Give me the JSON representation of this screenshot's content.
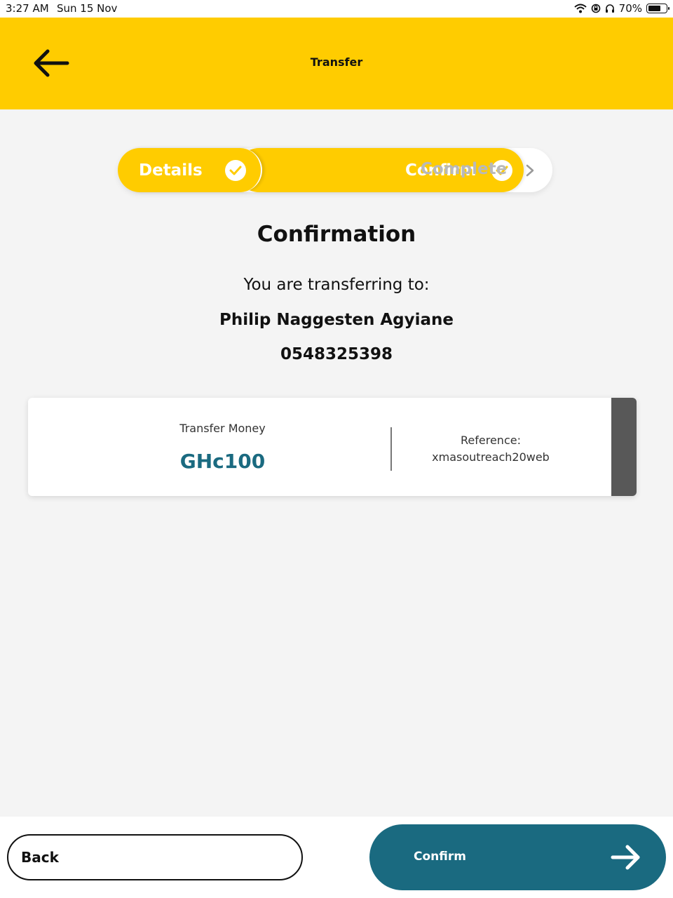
{
  "status_bar": {
    "time": "3:27 AM",
    "date": "Sun 15 Nov",
    "battery": "70%",
    "battery_level": 0.7,
    "icons": [
      "wifi-icon",
      "lock-rotation-icon",
      "headphones-icon",
      "battery-icon"
    ]
  },
  "header": {
    "title": "Transfer",
    "back_icon": "arrow-left-icon",
    "background_color": "#ffcc00"
  },
  "stepper": {
    "steps": [
      {
        "label": "Details",
        "state": "done",
        "icon": "check-circle-icon"
      },
      {
        "label": "Confirm",
        "state": "active",
        "icon": "check-circle-icon"
      },
      {
        "label": "Complete",
        "state": "pending",
        "icon": "chevron-right-icon"
      }
    ]
  },
  "confirmation": {
    "title": "Confirmation",
    "subtitle": "You are transferring to:",
    "recipient_name": "Philip Naggesten Agyiane",
    "recipient_phone": "0548325398"
  },
  "summary": {
    "amount_label": "Transfer Money",
    "amount": "GHc100",
    "reference_label": "Reference:",
    "reference_value": "xmasoutreach20web",
    "amount_color": "#1a6a80"
  },
  "footer": {
    "back_label": "Back",
    "confirm_label": "Confirm",
    "confirm_icon": "arrow-right-icon",
    "confirm_color": "#1a6a80"
  }
}
